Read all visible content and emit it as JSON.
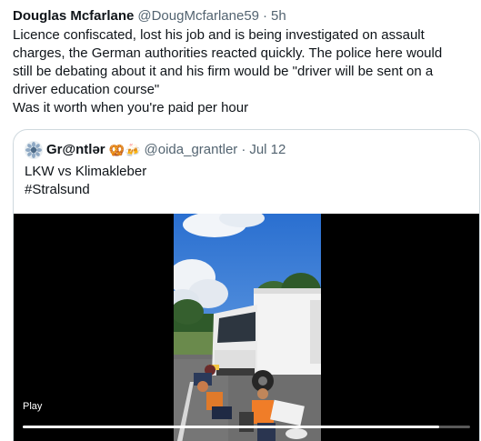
{
  "tweet": {
    "author_name": "Douglas Mcfarlane",
    "author_handle": "@DougMcfarlane59",
    "separator": "·",
    "time": "5h",
    "text_lines": [
      "Licence confiscated, lost his job and is being investigated on assault",
      "charges, the German authorities reacted quickly. The police here would",
      "still be debating about it and his firm would be \"driver will be sent on a",
      "driver education course\"",
      "Was it worth when you're paid per hour"
    ]
  },
  "quote": {
    "author_name": "Gr@ntlər",
    "author_emojis": "🥨🍻",
    "author_handle": "@oida_grantler",
    "separator": "·",
    "date": "Jul 12",
    "text_lines": [
      "LKW vs Klimakleber",
      "#Stralsund"
    ],
    "media": {
      "play_label": "Play",
      "progress_fraction": 0.93
    }
  },
  "colors": {
    "text_primary": "#0f1419",
    "text_secondary": "#536471",
    "border": "#cfd9de",
    "media_bg": "#000000"
  },
  "icons": {
    "quote_avatar": "sunflower-avatar-icon"
  }
}
